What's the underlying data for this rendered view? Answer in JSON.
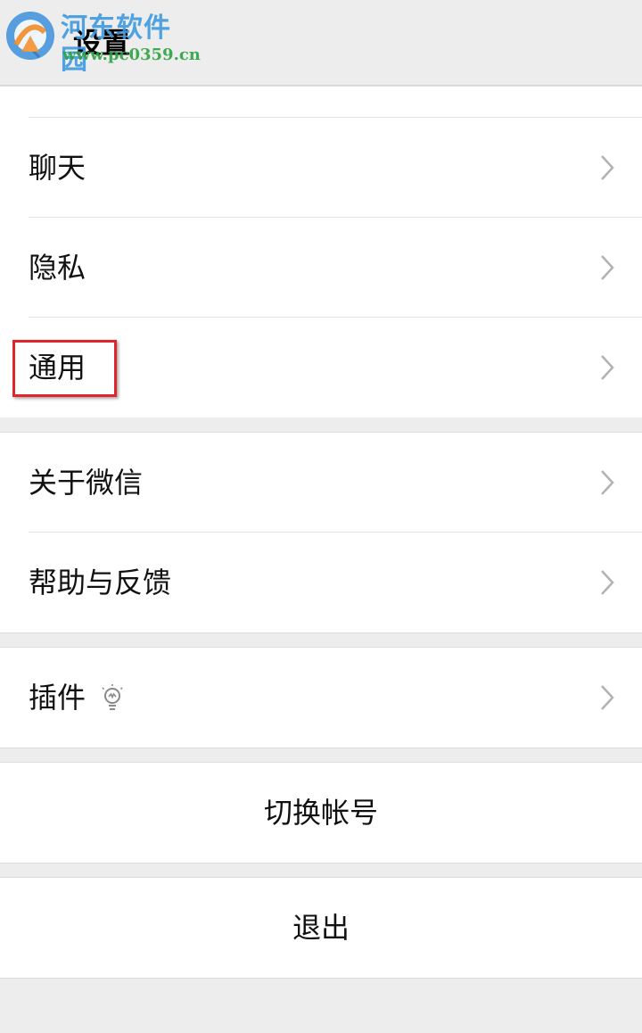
{
  "header": {
    "title": "设置",
    "back_icon": "chevron-left-icon"
  },
  "watermark": {
    "title": "河东软件园",
    "url": "www.pc0359.cn"
  },
  "groups": [
    {
      "items": [
        {
          "label": "聊天",
          "icon": "chevron-right-icon"
        },
        {
          "label": "隐私",
          "icon": "chevron-right-icon"
        },
        {
          "label": "通用",
          "icon": "chevron-right-icon",
          "highlighted": true
        }
      ]
    },
    {
      "items": [
        {
          "label": "关于微信",
          "icon": "chevron-right-icon"
        },
        {
          "label": "帮助与反馈",
          "icon": "chevron-right-icon"
        }
      ]
    },
    {
      "items": [
        {
          "label": "插件",
          "badge_icon": "lightbulb-icon",
          "icon": "chevron-right-icon"
        }
      ]
    }
  ],
  "actions": {
    "switch_account": "切换帐号",
    "logout": "退出"
  },
  "colors": {
    "background": "#ededed",
    "highlight": "#e0262b",
    "chevron": "#b2b2b2"
  }
}
